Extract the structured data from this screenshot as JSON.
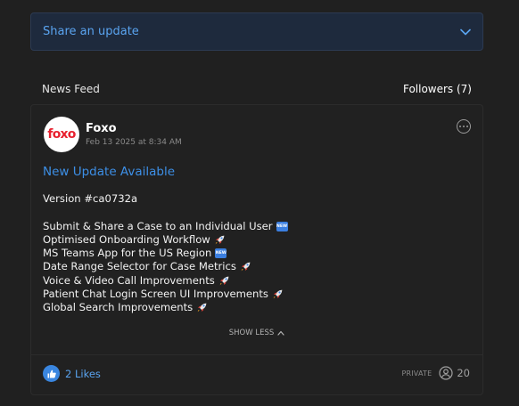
{
  "share": {
    "label": "Share an update",
    "icon": "chevron-down-icon"
  },
  "feed": {
    "title": "News Feed",
    "followers_label": "Followers (7)"
  },
  "post": {
    "author": "Foxo",
    "avatar_text": "foxo",
    "date": "Feb 13 2025 at 8:34 AM",
    "title": "New Update Available",
    "version": "Version #ca0732a",
    "items": [
      {
        "text": "Submit & Share a Case to an Individual User",
        "icon": "new-badge-icon",
        "badge_text": "NEW"
      },
      {
        "text": "Optimised Onboarding Workflow",
        "icon": "rocket-icon"
      },
      {
        "text": "MS Teams App for the US Region",
        "icon": "new-badge-icon",
        "badge_text": "NEW"
      },
      {
        "text": "Date Range Selector for Case Metrics",
        "icon": "rocket-icon"
      },
      {
        "text": "Voice & Video Call Improvements",
        "icon": "rocket-icon"
      },
      {
        "text": "Patient Chat Login Screen UI Improvements",
        "icon": "rocket-icon"
      },
      {
        "text": "Global Search Improvements",
        "icon": "rocket-icon"
      }
    ],
    "show_less_label": "SHOW LESS",
    "likes_label": "2 Likes",
    "visibility_label": "PRIVATE",
    "view_count": "20"
  },
  "colors": {
    "background": "#202020",
    "accent": "#3d8fe6",
    "share_bar": "#1e2a3d",
    "brand_red": "#e8212f"
  }
}
